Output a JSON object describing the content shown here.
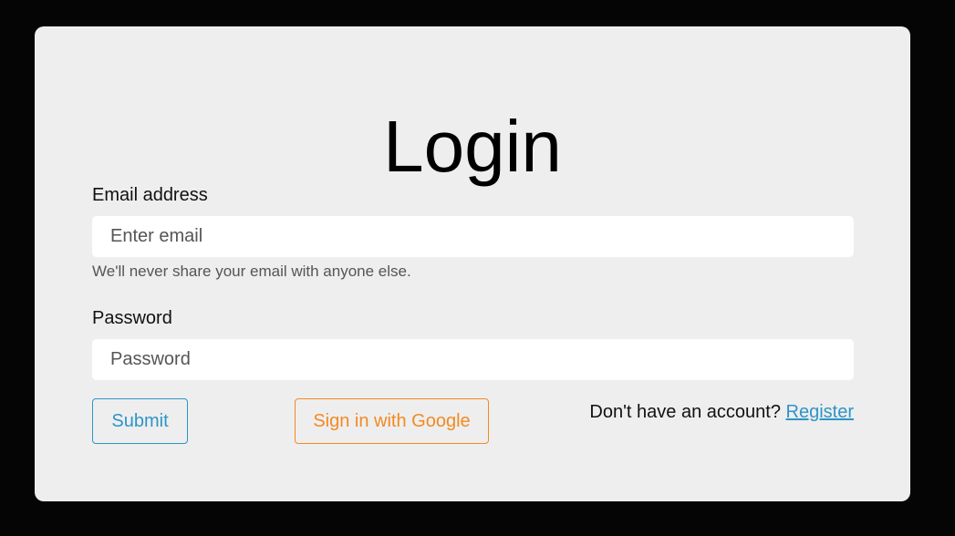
{
  "login": {
    "title": "Login",
    "email": {
      "label": "Email address",
      "placeholder": "Enter email",
      "value": "",
      "help": "We'll never share your email with anyone else."
    },
    "password": {
      "label": "Password",
      "placeholder": "Password",
      "value": ""
    },
    "submit_label": "Submit",
    "google_label": "Sign in with Google",
    "register_prompt": "Don't have an account?",
    "register_link": "Register"
  },
  "colors": {
    "background": "#050505",
    "card": "#eeeeee",
    "primary": "#2f94c8",
    "google": "#f38a23"
  }
}
